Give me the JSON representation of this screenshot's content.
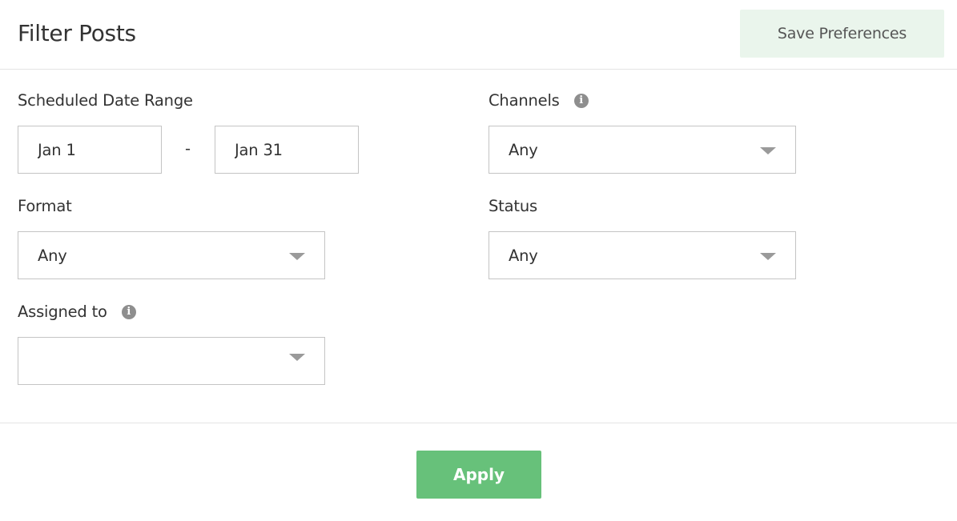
{
  "header": {
    "title": "Filter Posts",
    "save_label": "Save Preferences"
  },
  "date_range": {
    "label": "Scheduled Date Range",
    "start": "Jan 1",
    "separator": "-",
    "end": "Jan 31"
  },
  "channels": {
    "label": "Channels",
    "value": "Any",
    "icon": "info-icon"
  },
  "format": {
    "label": "Format",
    "value": "Any"
  },
  "status": {
    "label": "Status",
    "value": "Any"
  },
  "assigned": {
    "label": "Assigned to",
    "value": "",
    "icon": "info-icon"
  },
  "footer": {
    "apply_label": "Apply"
  },
  "colors": {
    "accent": "#67c17a",
    "save_bg": "#eaf5ec",
    "border": "#c4c4c4",
    "icon_gray": "#8e8e8e"
  }
}
